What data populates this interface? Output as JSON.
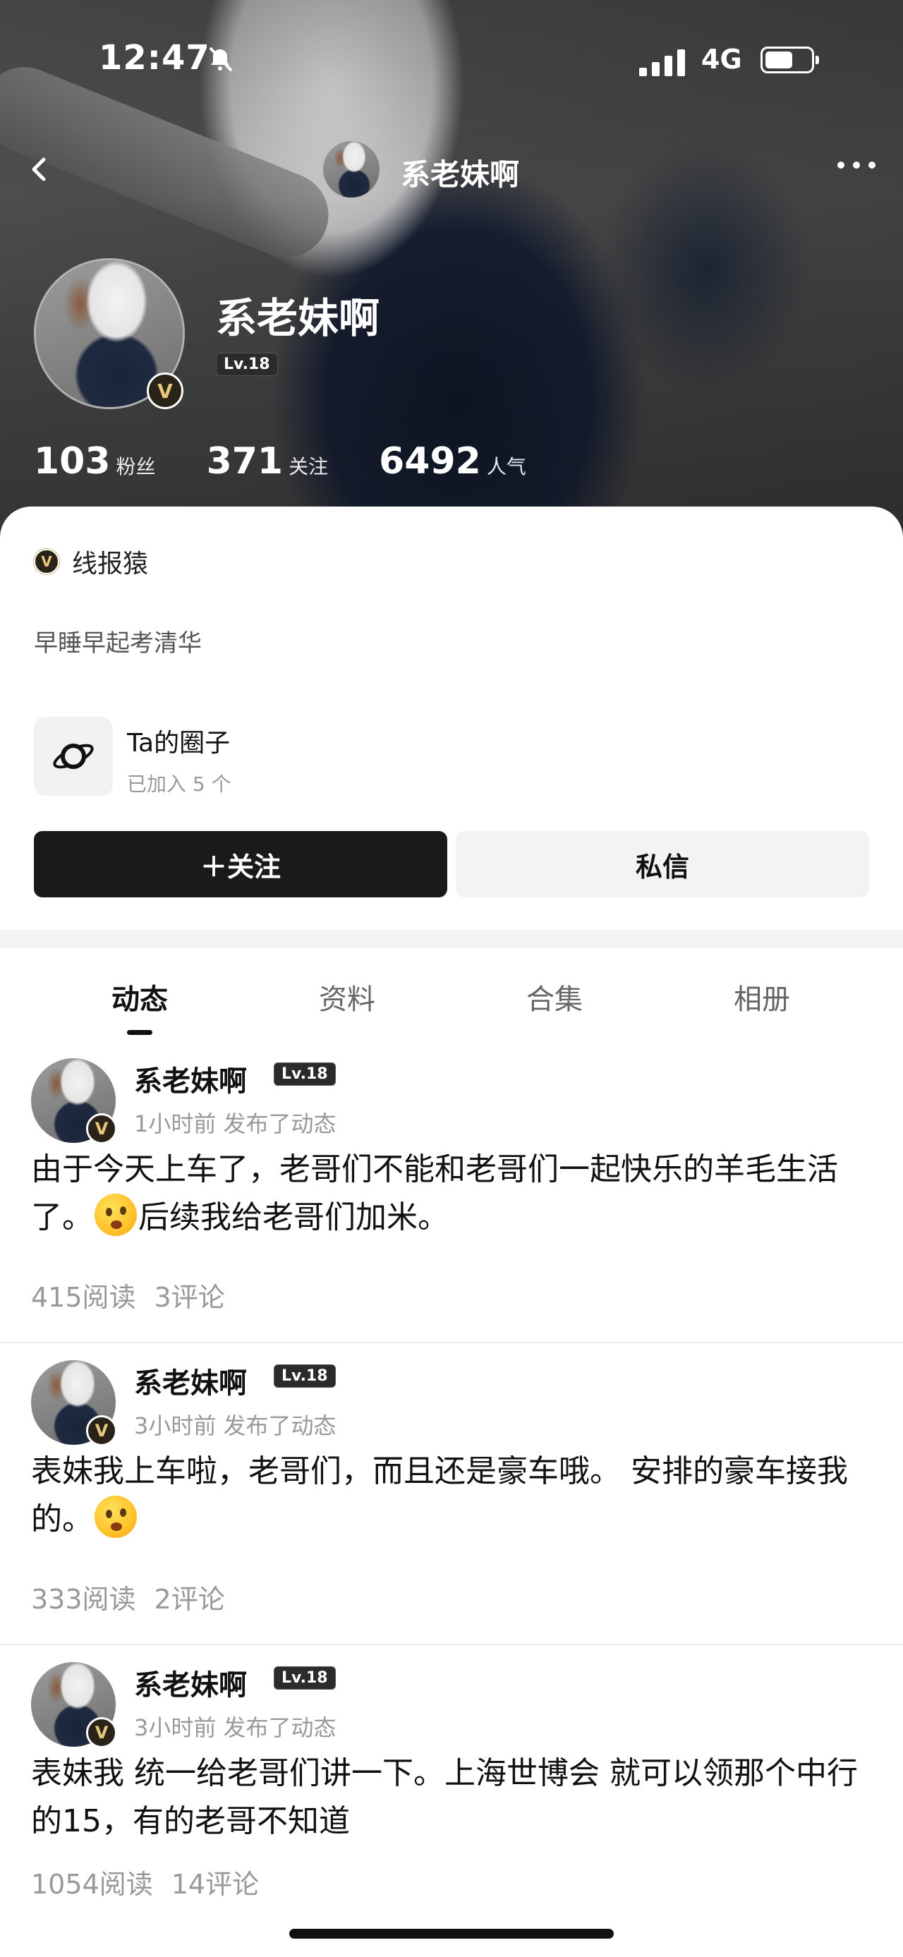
{
  "status": {
    "time": "12:47",
    "network": "4G"
  },
  "nav": {
    "title": "系老妹啊"
  },
  "profile": {
    "name": "系老妹啊",
    "level": "Lv.18",
    "verify_mark": "V",
    "stats": [
      {
        "num": "103",
        "label": "粉丝"
      },
      {
        "num": "371",
        "label": "关注"
      },
      {
        "num": "6492",
        "label": "人气"
      }
    ],
    "verify_text": "线报猿",
    "bio": "早睡早起考清华",
    "circle": {
      "title": "Ta的圈子",
      "subtitle": "已加入 5 个"
    },
    "follow_label": "＋关注",
    "message_label": "私信"
  },
  "tabs": [
    {
      "label": "动态",
      "active": true
    },
    {
      "label": "资料",
      "active": false
    },
    {
      "label": "合集",
      "active": false
    },
    {
      "label": "相册",
      "active": false
    }
  ],
  "posts": [
    {
      "name": "系老妹啊",
      "level": "Lv.18",
      "meta": "1小时前 发布了动态",
      "text_a": "由于今天上车了，老哥们不能和老哥们一起快乐的羊毛生活了。",
      "text_b": "后续我给老哥们加米。",
      "reads": "415阅读",
      "comments": "3评论"
    },
    {
      "name": "系老妹啊",
      "level": "Lv.18",
      "meta": "3小时前 发布了动态",
      "text_a": "表妹我上车啦，老哥们，而且还是豪车哦。 安排的豪车接我的。",
      "text_b": "",
      "reads": "333阅读",
      "comments": "2评论"
    },
    {
      "name": "系老妹啊",
      "level": "Lv.18",
      "meta": "3小时前 发布了动态",
      "text_a": "表妹我  统一给老哥们讲一下。上海世博会  就可以领那个中行的15，有的老哥不知道",
      "text_b": "",
      "reads": "1054阅读",
      "comments": "14评论"
    }
  ]
}
